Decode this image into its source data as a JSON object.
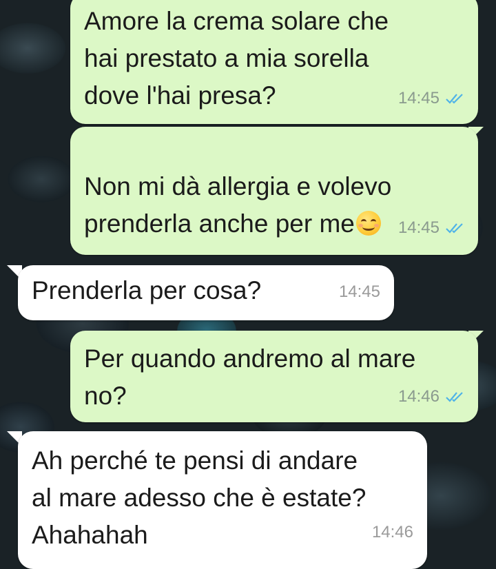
{
  "messages": [
    {
      "direction": "outgoing",
      "text": "Amore la crema solare che\nhai prestato a mia sorella\ndove l'hai presa?",
      "time": "14:45",
      "status": "read"
    },
    {
      "direction": "outgoing",
      "text": "Non mi dà allergia e volevo\nprenderla anche per me",
      "emoji": "smiling-face-emoji",
      "time": "14:45",
      "status": "read"
    },
    {
      "direction": "incoming",
      "text": "Prenderla per cosa?",
      "time": "14:45"
    },
    {
      "direction": "outgoing",
      "text": "Per quando andremo al mare\nno?",
      "time": "14:46",
      "status": "read"
    },
    {
      "direction": "incoming",
      "text": "Ah perché te pensi di andare\nal mare adesso che è estate?\nAhahahah",
      "time": "14:46"
    }
  ],
  "colors": {
    "outgoing_bubble": "#dcf8c6",
    "incoming_bubble": "#ffffff",
    "read_ticks": "#4fb3e8"
  },
  "icons": {
    "read_receipt": "double-check-icon",
    "emoji": "smiling-face-emoji"
  }
}
